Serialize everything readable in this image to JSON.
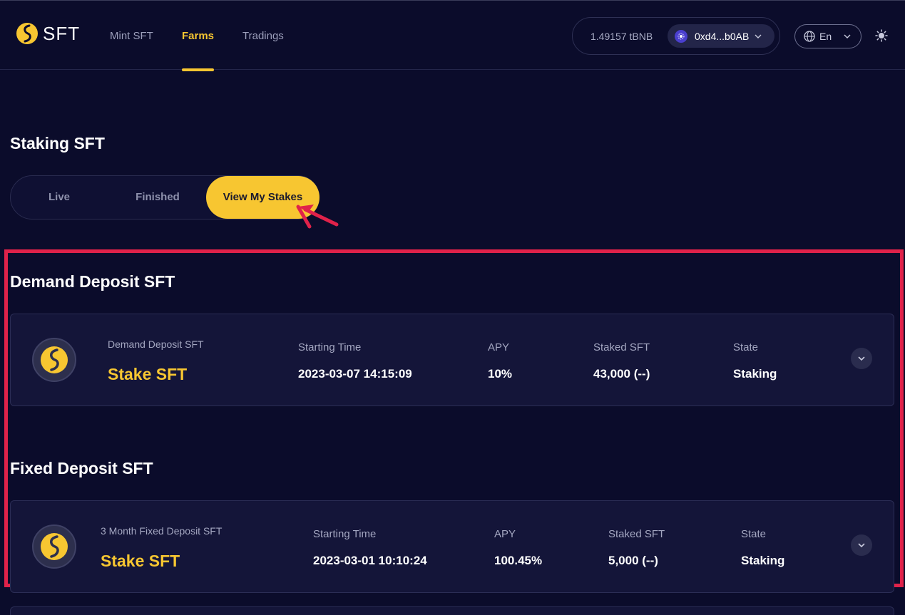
{
  "header": {
    "logo_text": "SFT",
    "nav": [
      "Mint SFT",
      "Farms",
      "Tradings"
    ],
    "active_nav": "Farms",
    "balance": "1.49157 tBNB",
    "address": "0xd4...b0AB",
    "language": "En"
  },
  "page": {
    "title": "Staking SFT",
    "tabs": [
      "Live",
      "Finished",
      "View My Stakes"
    ],
    "active_tab": "View My Stakes"
  },
  "columns": {
    "start": "Starting Time",
    "apy": "APY",
    "staked": "Staked SFT",
    "state": "State"
  },
  "sections": [
    {
      "title": "Demand Deposit SFT",
      "card": {
        "pool_name": "Demand Deposit SFT",
        "action": "Stake SFT",
        "starting_time": "2023-03-07 14:15:09",
        "apy": "10%",
        "staked": "43,000 (--)",
        "state": "Staking"
      }
    },
    {
      "title": "Fixed Deposit SFT",
      "card": {
        "pool_name": "3 Month Fixed Deposit SFT",
        "action": "Stake SFT",
        "starting_time": "2023-03-01 10:10:24",
        "apy": "100.45%",
        "staked": "5,000 (--)",
        "state": "Staking"
      }
    }
  ],
  "colors": {
    "background": "#0b0c2b",
    "accent": "#f7c631",
    "annotation": "#e0224a"
  },
  "icons": [
    "sft-logo-icon",
    "wallet-network-icon",
    "chevron-down-icon",
    "globe-icon",
    "sun-icon",
    "sft-coin-icon",
    "annotation-arrow-icon"
  ]
}
